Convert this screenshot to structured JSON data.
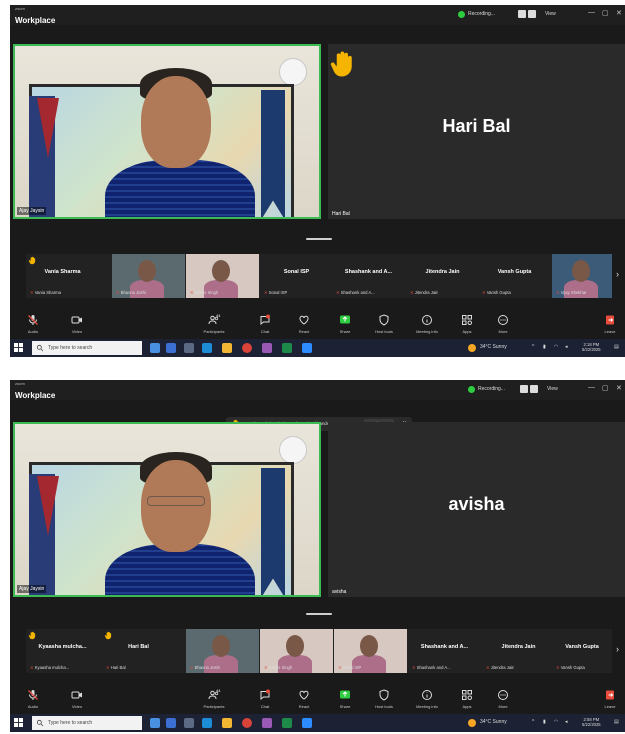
{
  "app": {
    "brand_small": "zoom",
    "brand": "Workplace"
  },
  "topbar": {
    "recording": "Recording...",
    "view": "View",
    "minimize": "—",
    "maximize": "▢",
    "close": "✕"
  },
  "toolbar": {
    "audio": "Audio",
    "video": "Video",
    "participants": "Participants",
    "participants_count": "44",
    "chat": "Chat",
    "react": "React",
    "share": "Share",
    "host_tools": "Host tools",
    "meeting_info": "Meeting info",
    "apps": "Apps",
    "more": "More",
    "leave": "Leave"
  },
  "taskbar": {
    "search_placeholder": "Type here to search",
    "weather": "34°C  Sunny"
  },
  "screens": [
    {
      "main_label": "Ajay Jaysin",
      "active_name": "Hari Bal",
      "active_label": "Hari Bal",
      "time": "2:18 PM",
      "date": "5/22/2025",
      "strip": [
        {
          "name": "Vania Sharma",
          "label": "Vania Sharma",
          "hand": true,
          "video": false
        },
        {
          "name": "",
          "label": "Bhavna Joshi",
          "hand": false,
          "video": true
        },
        {
          "name": "",
          "label": "Kalani Singh",
          "hand": false,
          "video": true
        },
        {
          "name": "Sonal ISP",
          "label": "Sonal ISP",
          "hand": false,
          "video": false
        },
        {
          "name": "Shashank and A...",
          "label": "Shashank and A...",
          "hand": false,
          "video": false
        },
        {
          "name": "Jitendra Jain",
          "label": "Jitendra Jain",
          "hand": false,
          "video": false
        },
        {
          "name": "Vansh Gupta",
          "label": "Vansh Gupta",
          "hand": false,
          "video": false
        },
        {
          "name": "",
          "label": "Vijay Shekhar",
          "hand": false,
          "video": true
        }
      ]
    },
    {
      "main_label": "Ajay Jaysin",
      "active_name": "avisha",
      "active_label": "avisha",
      "time": "2:58 PM",
      "date": "5/22/2025",
      "notice": "Kyaasha mulchandani +1 other raised hands",
      "notice_view": "View",
      "strip": [
        {
          "name": "Kyaasha mulcha...",
          "label": "Kyaasha mulcha...",
          "hand": true,
          "video": false
        },
        {
          "name": "Hari Bal",
          "label": "Hari Bal",
          "hand": true,
          "video": false
        },
        {
          "name": "",
          "label": "Bhavna Joshi",
          "hand": false,
          "video": true
        },
        {
          "name": "",
          "label": "Kalani Singh",
          "hand": false,
          "video": true
        },
        {
          "name": "",
          "label": "Sonal ISP",
          "hand": false,
          "video": true
        },
        {
          "name": "Shashank and A...",
          "label": "Shashank and A...",
          "hand": false,
          "video": false
        },
        {
          "name": "Jitendra Jain",
          "label": "Jitendra Jain",
          "hand": false,
          "video": false
        },
        {
          "name": "Vansh Gupta",
          "label": "Vansh Gupta",
          "hand": false,
          "video": false
        }
      ]
    }
  ],
  "colors": {
    "active_border": "#3cba54",
    "raised_hand": "#f5b400",
    "muted": "#e74c3c",
    "share": "#2ecc40"
  }
}
